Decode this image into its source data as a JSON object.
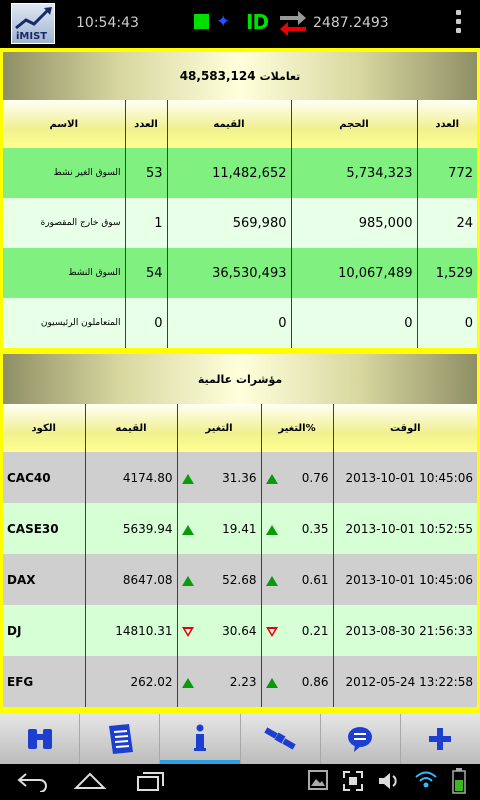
{
  "status": {
    "logo_text": "iMIST",
    "time": "10:54:43",
    "connection_label": "ID",
    "market_index": "2487.2493"
  },
  "summary": {
    "trades_count": "48,583,124",
    "trades_label": "تعاملات"
  },
  "market_table": {
    "headers": [
      "الاسم",
      "العدد",
      "القيمه",
      "الحجم",
      "العدد"
    ],
    "rows": [
      {
        "name": "السوق الغير نشط",
        "count1": "53",
        "value": "11,482,652",
        "volume": "5,734,323",
        "count2": "772"
      },
      {
        "name": "سوق خارج المقصورة",
        "count1": "1",
        "value": "569,980",
        "volume": "985,000",
        "count2": "24"
      },
      {
        "name": "السوق النشط",
        "count1": "54",
        "value": "36,530,493",
        "volume": "10,067,489",
        "count2": "1,529"
      },
      {
        "name": "المتعاملون الرئيسيون",
        "count1": "0",
        "value": "0",
        "volume": "0",
        "count2": "0"
      }
    ]
  },
  "global": {
    "title": "مؤشرات عالمية",
    "headers": [
      "الكود",
      "القيمه",
      "التغير",
      "التغير%",
      "الوقت"
    ],
    "rows": [
      {
        "code": "CAC40",
        "value": "4174.80",
        "change": "31.36",
        "dir": "up",
        "pct": "0.76",
        "time": "2013-10-01 10:45:06"
      },
      {
        "code": "CASE30",
        "value": "5639.94",
        "change": "19.41",
        "dir": "up",
        "pct": "0.35",
        "time": "2013-10-01 10:52:55"
      },
      {
        "code": "DAX",
        "value": "8647.08",
        "change": "52.68",
        "dir": "up",
        "pct": "0.61",
        "time": "2013-10-01 10:45:06"
      },
      {
        "code": "DJ",
        "value": "14810.31",
        "change": "30.64",
        "dir": "down",
        "pct": "0.21",
        "time": "2013-08-30 21:56:33"
      },
      {
        "code": "EFG",
        "value": "262.02",
        "change": "2.23",
        "dir": "up",
        "pct": "0.86",
        "time": "2012-05-24 13:22:58"
      }
    ]
  },
  "tabs": [
    {
      "icon": "binoculars-icon"
    },
    {
      "icon": "document-icon"
    },
    {
      "icon": "info-icon",
      "active": true
    },
    {
      "icon": "satellite-icon"
    },
    {
      "icon": "chat-icon"
    },
    {
      "icon": "plus-icon"
    }
  ],
  "colors": {
    "panel_yellow": "#ffff00",
    "row_green": "#80f080",
    "row_light": "#e8ffe8",
    "up_green": "#0a9a0a",
    "down_red": "#e00000",
    "divider_blue": "#2233cc",
    "tab_active": "#2aa0e0"
  }
}
